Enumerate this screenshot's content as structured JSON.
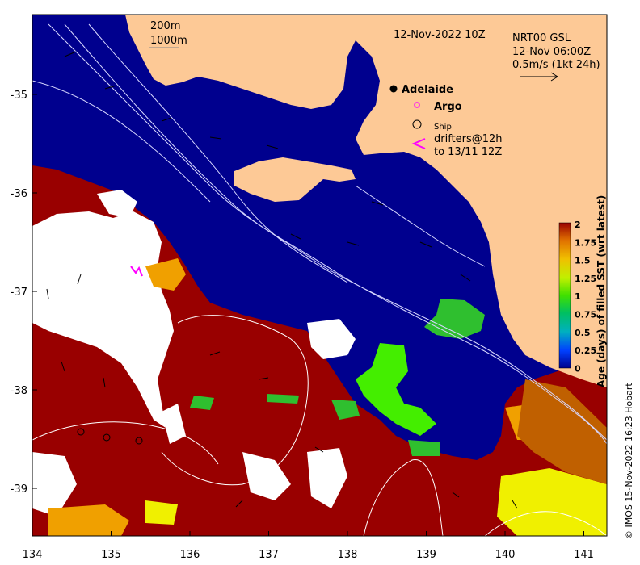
{
  "map": {
    "date_label": "12-Nov-2022 10Z",
    "contour_labels": [
      "200m",
      "1000m"
    ],
    "current_header": [
      "NRT00 GSL",
      "12-Nov 06:00Z",
      "0.5m/s (1kt 24h)"
    ],
    "legend": {
      "city": "Adelaide",
      "argo": "Argo",
      "ship": "Ship",
      "drifters": [
        "drifters@12h",
        "to 13/11 12Z"
      ]
    },
    "x_ticks": [
      "134",
      "135",
      "136",
      "137",
      "138",
      "139",
      "140",
      "141"
    ],
    "y_ticks": [
      "-35",
      "-36",
      "-37",
      "-38",
      "-39"
    ],
    "credit": "© IMOS 15-Nov-2022 16:23 Hobart",
    "colors": {
      "land": "#fdc996",
      "ocean_fresh": "#00008e",
      "stale": "#990000",
      "mid_green": "#2fbf2f",
      "bright_green": "#44ee00",
      "yellow": "#f0f000",
      "orange": "#f0a000",
      "white_gap": "#ffffff",
      "argo": "#ff00ff"
    }
  },
  "colorbar": {
    "title": "Age (days) of filled SST (wrt latest)",
    "ticks": [
      "2",
      "1.75",
      "1.5",
      "1.25",
      "1",
      "0.75",
      "0.5",
      "0.25",
      "0"
    ],
    "range": [
      0,
      2
    ],
    "stops": [
      "#00008e",
      "#0040ff",
      "#00b0c0",
      "#00c060",
      "#40e000",
      "#c0f000",
      "#f0c000",
      "#e07000",
      "#990000"
    ]
  }
}
